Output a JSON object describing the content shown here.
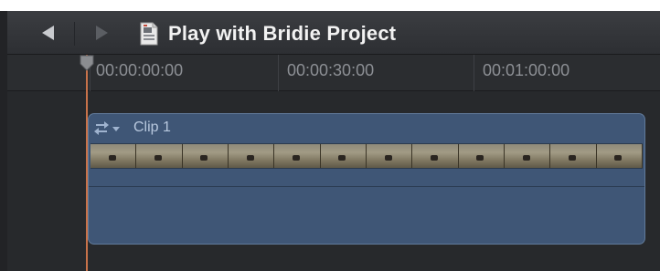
{
  "toolbar": {
    "back_icon": "back-arrow-icon",
    "forward_icon": "forward-arrow-icon",
    "project_icon": "project-document-icon",
    "title": "Play with Bridie Project"
  },
  "ruler": {
    "timecodes": [
      "00:00:00:00",
      "00:00:30:00",
      "00:01:00:00"
    ]
  },
  "clip": {
    "menu_icon": "clip-menu-icon",
    "name": "Clip 1",
    "color": "#3f5676",
    "filmstrip_frame_count": 12
  },
  "colors": {
    "playhead": "#c8724a",
    "clip_name": "#b8c8de"
  }
}
